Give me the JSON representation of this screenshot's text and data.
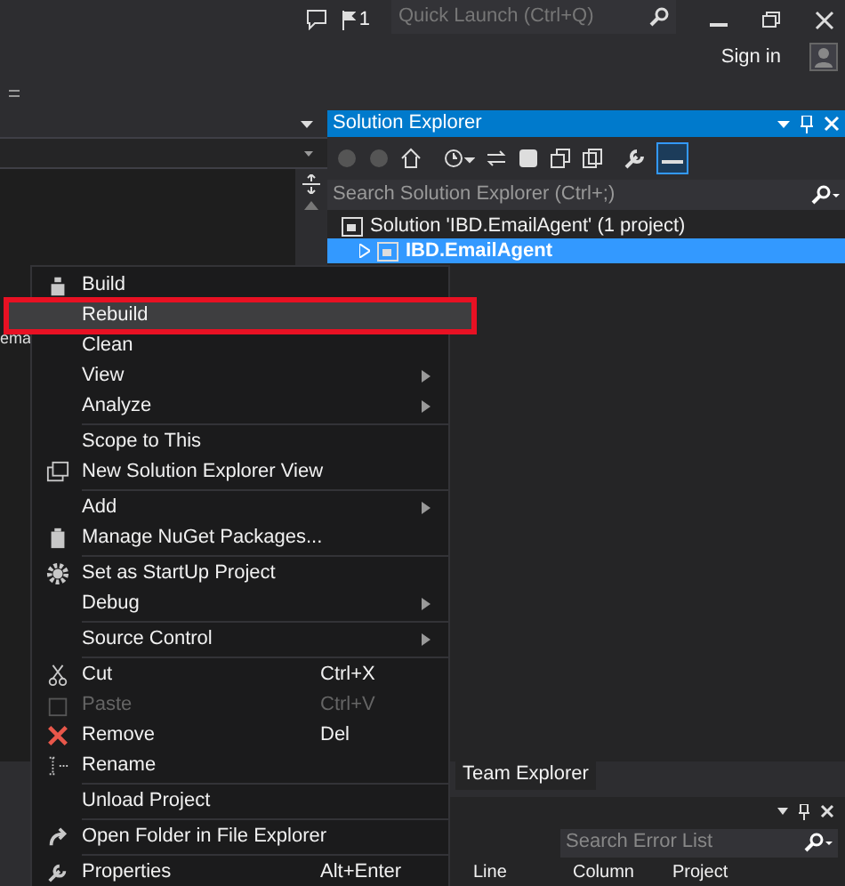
{
  "title_bar": {
    "notification_count": "1",
    "quick_launch": {
      "placeholder": "Quick Launch (Ctrl+Q)"
    },
    "sign_in": "Sign in"
  },
  "editor": {
    "visible_text": "ema"
  },
  "solution_explorer": {
    "title": "Solution Explorer",
    "search": {
      "placeholder": "Search Solution Explorer (Ctrl+;)"
    },
    "tree": [
      {
        "label": "Solution 'IBD.EmailAgent' (1 project)",
        "selected": false,
        "children": [
          {
            "label": "IBD.EmailAgent",
            "selected": true,
            "expanded": false
          }
        ]
      }
    ]
  },
  "bottom_tabs": [
    {
      "label": "Team Explorer",
      "selected": false
    }
  ],
  "error_list": {
    "search": {
      "placeholder": "Search Error List"
    },
    "columns": [
      "Line",
      "Column",
      "Project"
    ]
  },
  "context_menu": [
    {
      "kind": "item",
      "label": "Build",
      "highlighted": false
    },
    {
      "kind": "item",
      "label": "Rebuild",
      "highlighted": true
    },
    {
      "kind": "item",
      "label": "Clean",
      "highlighted": false
    },
    {
      "kind": "item",
      "label": "View",
      "submenu": true,
      "highlighted": false
    },
    {
      "kind": "item",
      "label": "Analyze",
      "submenu": true,
      "highlighted": false
    },
    {
      "kind": "separator"
    },
    {
      "kind": "item",
      "label": "Scope to This",
      "highlighted": false
    },
    {
      "kind": "item",
      "label": "New Solution Explorer View",
      "highlighted": false
    },
    {
      "kind": "separator"
    },
    {
      "kind": "item",
      "label": "Add",
      "submenu": true,
      "highlighted": false
    },
    {
      "kind": "item",
      "label": "Manage NuGet Packages...",
      "highlighted": false
    },
    {
      "kind": "separator"
    },
    {
      "kind": "item",
      "label": "Set as StartUp Project",
      "highlighted": false
    },
    {
      "kind": "item",
      "label": "Debug",
      "submenu": true,
      "highlighted": false
    },
    {
      "kind": "separator"
    },
    {
      "kind": "item",
      "label": "Source Control",
      "submenu": true,
      "highlighted": false
    },
    {
      "kind": "separator"
    },
    {
      "kind": "item",
      "label": "Cut",
      "shortcut": "Ctrl+X",
      "highlighted": false
    },
    {
      "kind": "item",
      "label": "Paste",
      "shortcut": "Ctrl+V",
      "disabled": true,
      "highlighted": false
    },
    {
      "kind": "item",
      "label": "Remove",
      "shortcut": "Del",
      "highlighted": false
    },
    {
      "kind": "item",
      "label": "Rename",
      "highlighted": false
    },
    {
      "kind": "separator"
    },
    {
      "kind": "item",
      "label": "Unload Project",
      "highlighted": false
    },
    {
      "kind": "separator"
    },
    {
      "kind": "item",
      "label": "Open Folder in File Explorer",
      "highlighted": false
    },
    {
      "kind": "separator"
    },
    {
      "kind": "item",
      "label": "Properties",
      "shortcut": "Alt+Enter",
      "highlighted": false
    }
  ]
}
